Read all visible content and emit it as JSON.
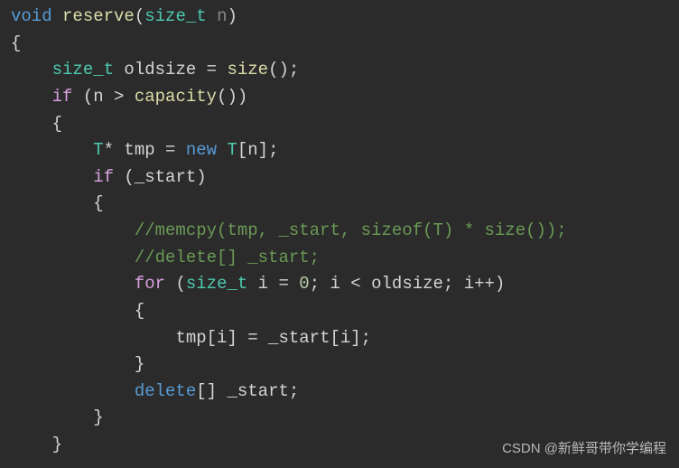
{
  "code": {
    "l0": {
      "a": "void",
      "b": " ",
      "c": "reserve",
      "d": "(",
      "e": "size_t",
      "f": " n",
      "g": ")"
    },
    "l1": "{",
    "l2": {
      "a": "size_t",
      "b": " oldsize = ",
      "c": "size",
      "d": "();"
    },
    "l3": {
      "a": "if",
      "b": " (n > ",
      "c": "capacity",
      "d": "())"
    },
    "l4": "{",
    "l5": {
      "a": "T",
      "b": "* tmp = ",
      "c": "new",
      "d": " ",
      "e": "T",
      "f": "[n];"
    },
    "l6": {
      "a": "if",
      "b": " (_start)"
    },
    "l7": "{",
    "l8": "//memcpy(tmp, _start, sizeof(T) * size());",
    "l9": "//delete[] _start;",
    "l10": {
      "a": "for",
      "b": " (",
      "c": "size_t",
      "d": " i = ",
      "e": "0",
      "f": "; i < oldsize; i++)"
    },
    "l11": "{",
    "l12": "tmp[i] = _start[i];",
    "l13": "}",
    "l14": {
      "a": "delete",
      "b": "[] _start;"
    },
    "l15": "}",
    "l16": "}"
  },
  "watermark": "CSDN @新鲜哥带你学编程"
}
